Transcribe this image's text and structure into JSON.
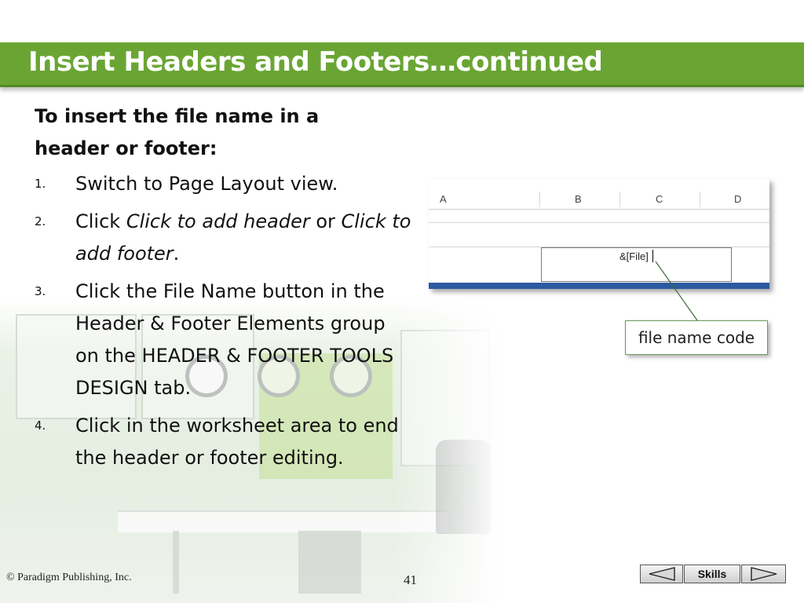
{
  "slide": {
    "title": "Insert Headers and Footers…continued",
    "intro": "To insert the file name in a header or footer:",
    "steps": [
      {
        "num": "1.",
        "text": "Switch to Page Layout view."
      },
      {
        "num": "2.",
        "pre": "Click ",
        "italic1": "Click to add header",
        "mid": " or ",
        "italic2": "Click to add footer",
        "post": "."
      },
      {
        "num": "3.",
        "text": "Click the File Name button in the Header & Footer Elements group on the HEADER & FOOTER TOOLS DESIGN tab."
      },
      {
        "num": "4.",
        "text": "Click in the worksheet area to end the header or footer editing."
      }
    ]
  },
  "sheet": {
    "columns": [
      "A",
      "B",
      "C",
      "D"
    ],
    "header_code": "&[File]"
  },
  "callout": {
    "label": "file name code"
  },
  "footer": {
    "copyright": "© Paradigm Publishing, Inc.",
    "page_number": "41",
    "nav": {
      "skills_label": "Skills"
    }
  },
  "colors": {
    "title_bar": "#6aa534",
    "sheet_bottom_bar": "#2b5aa0"
  }
}
